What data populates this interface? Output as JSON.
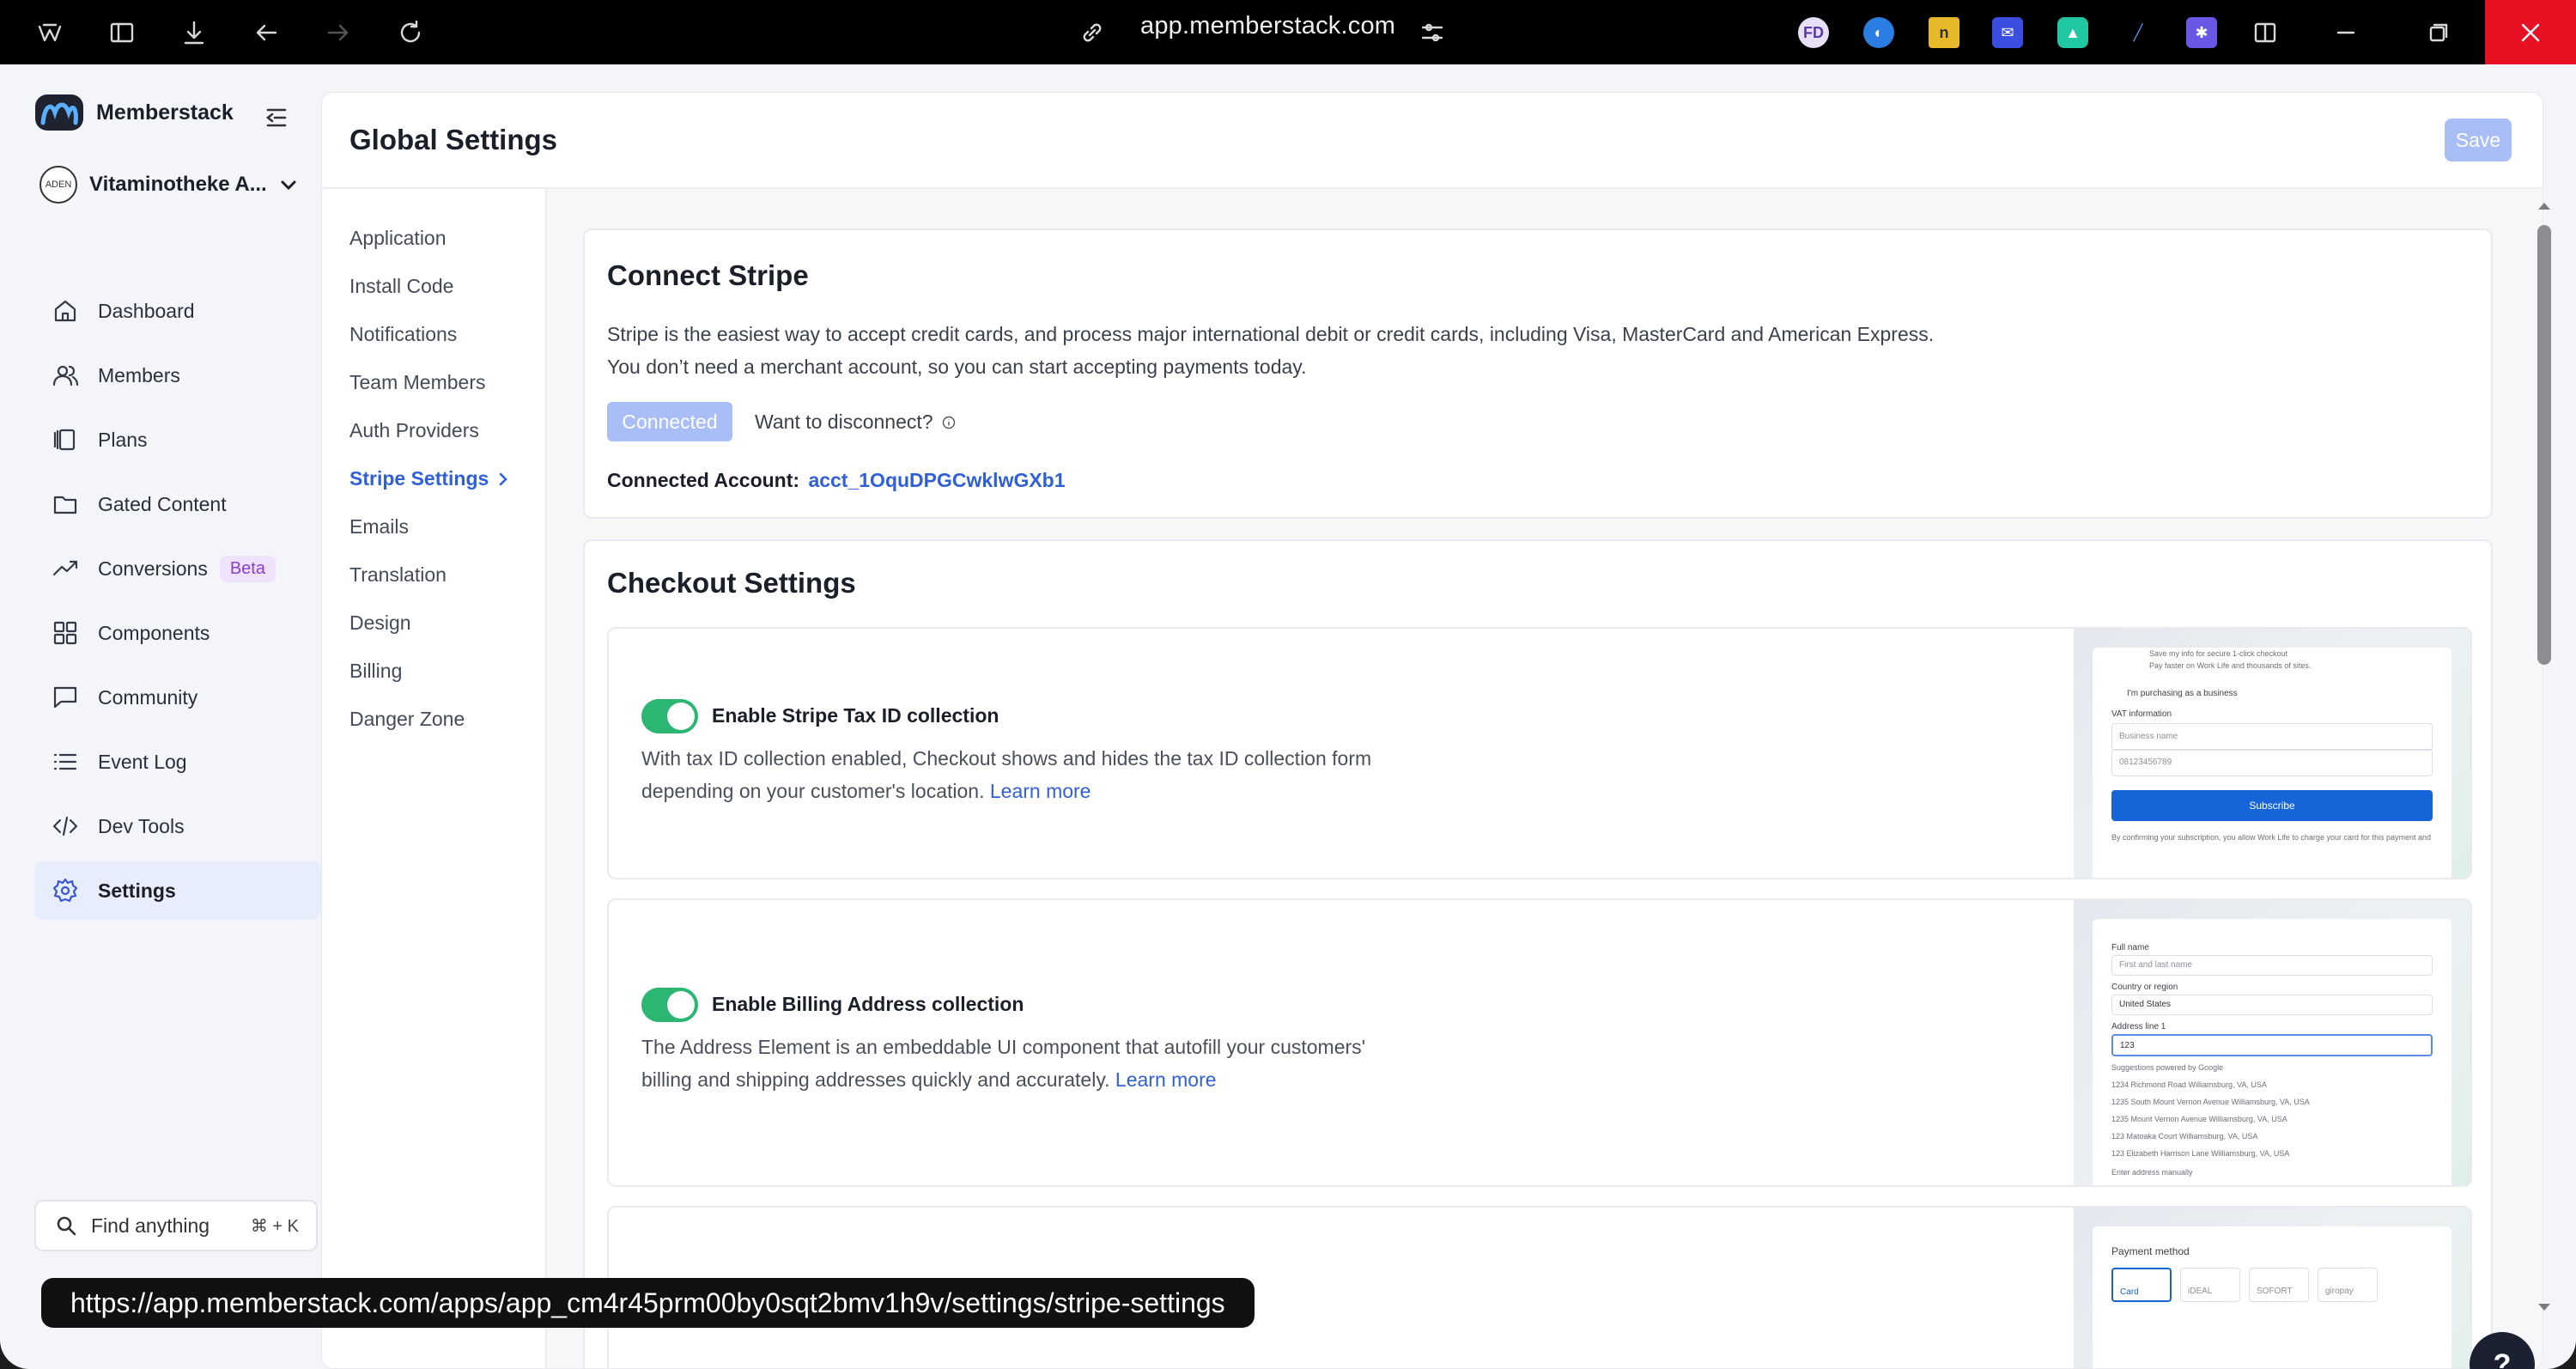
{
  "browser": {
    "url": "app.memberstack.com",
    "hover_url": "https://app.memberstack.com/apps/app_cm4r45prm00by0sqt2bmv1h9v/settings/stripe-settings"
  },
  "sidebar": {
    "brand": "Memberstack",
    "workspace": "Vitaminotheke A...",
    "workspace_avatar_text": "ADEN",
    "items": [
      {
        "label": "Dashboard",
        "icon": "home-icon"
      },
      {
        "label": "Members",
        "icon": "users-icon"
      },
      {
        "label": "Plans",
        "icon": "plans-icon"
      },
      {
        "label": "Gated Content",
        "icon": "folder-icon"
      },
      {
        "label": "Conversions",
        "icon": "trend-icon",
        "badge": "Beta"
      },
      {
        "label": "Components",
        "icon": "grid-icon"
      },
      {
        "label": "Community",
        "icon": "chat-icon"
      },
      {
        "label": "Event Log",
        "icon": "list-icon"
      },
      {
        "label": "Dev Tools",
        "icon": "code-icon"
      },
      {
        "label": "Settings",
        "icon": "gear-icon",
        "active": true
      }
    ],
    "search_label": "Find anything",
    "search_shortcut": "⌘ + K"
  },
  "header": {
    "title": "Global Settings",
    "save_label": "Save"
  },
  "sub_nav": {
    "items": [
      {
        "label": "Application"
      },
      {
        "label": "Install Code"
      },
      {
        "label": "Notifications"
      },
      {
        "label": "Team Members"
      },
      {
        "label": "Auth Providers"
      },
      {
        "label": "Stripe Settings",
        "active": true
      },
      {
        "label": "Emails"
      },
      {
        "label": "Translation"
      },
      {
        "label": "Design"
      },
      {
        "label": "Billing"
      },
      {
        "label": "Danger Zone"
      }
    ]
  },
  "stripe": {
    "title": "Connect Stripe",
    "desc_line1": "Stripe is the easiest way to accept credit cards, and process major international debit or credit cards, including Visa, MasterCard and American Express.",
    "desc_line2": "You don’t need a merchant account, so you can start accepting payments today.",
    "connected_label": "Connected",
    "disconnect_prompt": "Want to disconnect?",
    "account_label": "Connected Account:",
    "account_id": "acct_1OquDPGCwklwGXb1"
  },
  "checkout": {
    "title": "Checkout Settings",
    "tax": {
      "label": "Enable Stripe Tax ID collection",
      "enabled": true,
      "desc": "With tax ID collection enabled, Checkout shows and hides the tax ID collection form depending on your customer's location.",
      "link": "Learn more",
      "preview": {
        "save_line": "Save my info for secure 1-click checkout",
        "pay_line": "Pay faster on Work Life and thousands of sites.",
        "business_check": "I'm purchasing as a business",
        "vat_label": "VAT information",
        "business_placeholder": "Business name",
        "vat_placeholder": "08123456789",
        "subscribe": "Subscribe",
        "fine_print": "By confirming your subscription, you allow Work Life to charge your card for this payment and future payments in accordance"
      }
    },
    "billing": {
      "label": "Enable Billing Address collection",
      "enabled": true,
      "desc": "The Address Element is an embeddable UI component that autofill your customers' billing and shipping addresses quickly and accurately.",
      "link": "Learn more",
      "preview": {
        "full_name_label": "Full name",
        "full_name_placeholder": "First and last name",
        "country_label": "Country or region",
        "country_value": "United States",
        "address_label": "Address line 1",
        "address_value": "123",
        "suggestions_label": "Suggestions powered by Google",
        "suggestions": [
          "1234 Richmond Road  Williamsburg, VA, USA",
          "1235 South Mount Vernon Avenue  Williamsburg, VA, USA",
          "1235 Mount Vernon Avenue  Williamsburg, VA, USA",
          "123 Matoaka Court  Williamsburg, VA, USA",
          "123 Elizabeth Harrison Lane  Williamsburg, VA, USA"
        ],
        "manual": "Enter address manually"
      }
    },
    "payment": {
      "preview": {
        "title": "Payment method",
        "methods": [
          "Card",
          "iDEAL",
          "SOFORT",
          "giropay"
        ]
      }
    }
  },
  "help_label": "?"
}
